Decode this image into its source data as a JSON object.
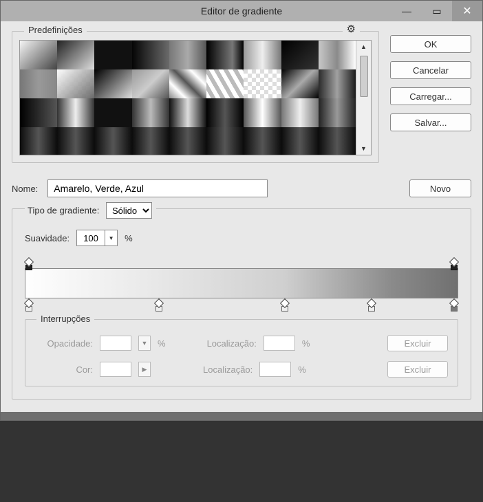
{
  "window": {
    "title": "Editor de gradiente"
  },
  "presets": {
    "label": "Predefinições"
  },
  "buttons": {
    "ok": "OK",
    "cancel": "Cancelar",
    "load": "Carregar...",
    "save": "Salvar...",
    "new": "Novo"
  },
  "name": {
    "label": "Nome:",
    "value": "Amarelo, Verde, Azul"
  },
  "gradient": {
    "type_label": "Tipo de gradiente:",
    "type_value": "Sólido",
    "smooth_label": "Suavidade:",
    "smooth_value": "100",
    "percent": "%"
  },
  "stops": {
    "label": "Interrupções",
    "opacity_label": "Opacidade:",
    "color_label": "Cor:",
    "location_label": "Localização:",
    "delete": "Excluir",
    "percent": "%"
  },
  "icons": {
    "gear": "⚙"
  }
}
